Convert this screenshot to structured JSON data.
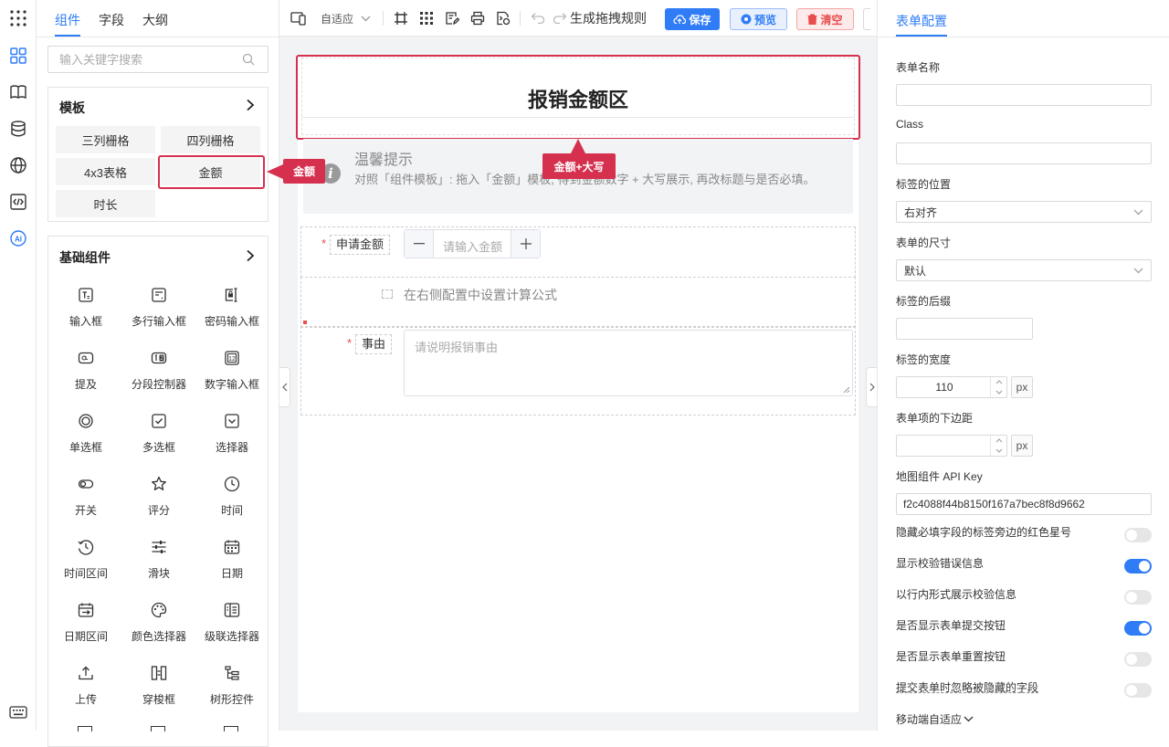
{
  "left_tabs": [
    "组件",
    "字段",
    "大纲"
  ],
  "search": {
    "placeholder": "输入关键字搜索"
  },
  "templates": {
    "title": "模板",
    "items": [
      "三列栅格",
      "四列栅格",
      "4x3表格",
      "金额",
      "时长"
    ]
  },
  "basic": {
    "title": "基础组件",
    "items": [
      {
        "label": "输入框",
        "icon": "text-input-icon"
      },
      {
        "label": "多行输入框",
        "icon": "textarea-icon"
      },
      {
        "label": "密码输入框",
        "icon": "password-icon"
      },
      {
        "label": "提及",
        "icon": "mention-icon"
      },
      {
        "label": "分段控制器",
        "icon": "segmented-icon"
      },
      {
        "label": "数字输入框",
        "icon": "number-input-icon"
      },
      {
        "label": "单选框",
        "icon": "radio-icon"
      },
      {
        "label": "多选框",
        "icon": "checkbox-icon"
      },
      {
        "label": "选择器",
        "icon": "select-icon"
      },
      {
        "label": "开关",
        "icon": "switch-icon"
      },
      {
        "label": "评分",
        "icon": "star-icon"
      },
      {
        "label": "时间",
        "icon": "clock-icon"
      },
      {
        "label": "时间区间",
        "icon": "time-range-icon"
      },
      {
        "label": "滑块",
        "icon": "slider-icon"
      },
      {
        "label": "日期",
        "icon": "calendar-icon"
      },
      {
        "label": "日期区间",
        "icon": "date-range-icon"
      },
      {
        "label": "颜色选择器",
        "icon": "palette-icon"
      },
      {
        "label": "级联选择器",
        "icon": "cascader-icon"
      },
      {
        "label": "上传",
        "icon": "upload-icon"
      },
      {
        "label": "穿梭框",
        "icon": "transfer-icon"
      },
      {
        "label": "树形控件",
        "icon": "tree-icon"
      }
    ]
  },
  "toolbar": {
    "adapt": "自适应",
    "rule": "生成拖拽规则",
    "save": "保存",
    "preview": "预览",
    "clear": "清空"
  },
  "form": {
    "title": "报销金额区",
    "tip_title": "温馨提示",
    "tip_body": "对照「组件模板」: 拖入「金额」模板, 得到金额数字 + 大写展示, 再改标题与是否必填。",
    "amount_label": "申请金额",
    "amount_placeholder": "请输入金额",
    "formula_hint": "在右侧配置中设置计算公式",
    "reason_label": "事由",
    "reason_placeholder": "请说明报销事由",
    "required_mark": "*"
  },
  "callouts": {
    "amount": "金额",
    "amount_upper": "金额+大写"
  },
  "right": {
    "tab": "表单配置",
    "form_name": "表单名称",
    "class_label": "Class",
    "label_position": "标签的位置",
    "label_position_value": "右对齐",
    "form_size": "表单的尺寸",
    "form_size_value": "默认",
    "label_suffix": "标签的后缀",
    "label_width": "标签的宽度",
    "label_width_value": "110",
    "px": "px",
    "item_margin": "表单项的下边距",
    "map_key_label": "地图组件 API Key",
    "map_key_value": "f2c4088f44b8150f167a7bec8f8d9662",
    "toggles": [
      {
        "label": "隐藏必填字段的标签旁边的红色星号",
        "on": false
      },
      {
        "label": "显示校验错误信息",
        "on": true
      },
      {
        "label": "以行内形式展示校验信息",
        "on": false
      },
      {
        "label": "是否显示表单提交按钮",
        "on": true
      },
      {
        "label": "是否显示表单重置按钮",
        "on": false
      },
      {
        "label": "提交表单时忽略被隐藏的字段",
        "on": false
      }
    ],
    "mobile": "移动端自适应"
  },
  "colors": {
    "accent": "#2f7cf6",
    "highlight": "#d6304f",
    "danger": "#e84c4c"
  }
}
